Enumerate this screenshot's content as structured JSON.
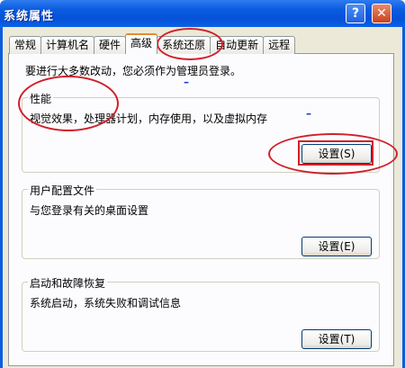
{
  "window": {
    "title": "系统属性",
    "help_button": "?",
    "close_button": "✕"
  },
  "tabs": [
    {
      "label": "常规"
    },
    {
      "label": "计算机名"
    },
    {
      "label": "硬件"
    },
    {
      "label": "高级"
    },
    {
      "label": "系统还原"
    },
    {
      "label": "自动更新"
    },
    {
      "label": "远程"
    }
  ],
  "active_tab": "高级",
  "notice": "要进行大多数改动，您必须作为管理员登录。",
  "groups": {
    "performance": {
      "title": "性能",
      "description": "视觉效果，处理器计划，内存使用，以及虚拟内存",
      "button": "设置(S)"
    },
    "user_profiles": {
      "title": "用户配置文件",
      "description": "与您登录有关的桌面设置",
      "button": "设置(E)"
    },
    "startup_recovery": {
      "title": "启动和故障恢复",
      "description": "系统启动，系统失败和调试信息",
      "button": "设置(T)"
    }
  },
  "annotation_color": "#d0202a"
}
